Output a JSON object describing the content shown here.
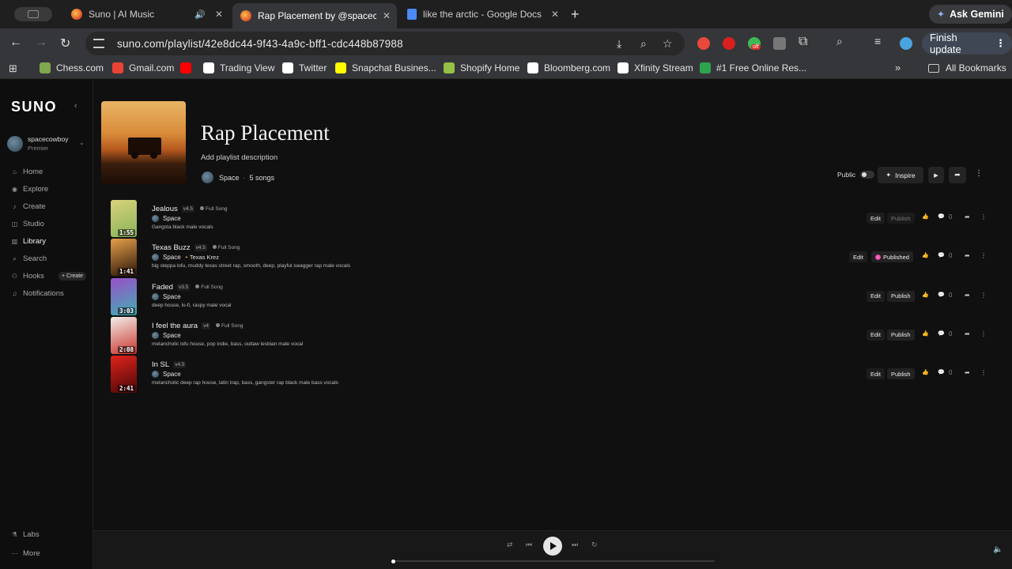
{
  "browser": {
    "tabs": [
      {
        "title": "Suno | AI Music",
        "active": false
      },
      {
        "title": "Rap Placement by @spacecowboy",
        "active": true
      },
      {
        "title": "like the arctic - Google Docs",
        "active": false
      }
    ],
    "ask_gemini": "Ask Gemini",
    "url_host": "suno.com",
    "url_path": "/playlist/42e8dc44-9f43-4a9c-bff1-cdc448b87988",
    "extension_badge": "off",
    "finish_update": "Finish update",
    "bookmarks": [
      {
        "label": "Chess.com",
        "icon": "chess-pawn-icon",
        "color": "#7fa650"
      },
      {
        "label": "Gmail.com",
        "icon": "gmail-icon",
        "color": "#ea4335"
      },
      {
        "label": "",
        "icon": "youtube-icon",
        "color": "#ff0000"
      },
      {
        "label": "Trading View",
        "icon": "tradingview-icon",
        "color": "#ffffff"
      },
      {
        "label": "Twitter",
        "icon": "x-icon",
        "color": "#ffffff"
      },
      {
        "label": "Snapchat Busines...",
        "icon": "snapchat-icon",
        "color": "#fffc00"
      },
      {
        "label": "Shopify Home",
        "icon": "shopify-icon",
        "color": "#95bf47"
      },
      {
        "label": "Bloomberg.com",
        "icon": "bloomberg-icon",
        "color": "#ffffff"
      },
      {
        "label": "Xfinity Stream",
        "icon": "xfinity-icon",
        "color": "#ffffff"
      },
      {
        "label": "#1 Free Online Res...",
        "icon": "resume-icon",
        "color": "#2ea44f"
      }
    ],
    "all_bookmarks": "All Bookmarks"
  },
  "sidebar": {
    "logo": "SUNO",
    "user": {
      "name": "spacecowboy",
      "plan": "Premier"
    },
    "items": [
      {
        "label": "Home",
        "icon": "home-icon"
      },
      {
        "label": "Explore",
        "icon": "compass-icon"
      },
      {
        "label": "Create",
        "icon": "music-note-icon"
      },
      {
        "label": "Studio",
        "icon": "studio-icon"
      },
      {
        "label": "Library",
        "icon": "library-icon",
        "active": true
      },
      {
        "label": "Search",
        "icon": "search-icon"
      },
      {
        "label": "Hooks",
        "icon": "hooks-icon"
      },
      {
        "label": "Notifications",
        "icon": "bell-icon"
      }
    ],
    "hooks_create": "+ Create",
    "bottom": [
      {
        "label": "Labs",
        "icon": "flask-icon"
      },
      {
        "label": "More",
        "icon": "more-icon"
      }
    ]
  },
  "playlist": {
    "title": "Rap Placement",
    "description_placeholder": "Add playlist description",
    "owner": "Space",
    "song_count": "5 songs",
    "public_label": "Public",
    "inspire_label": "Inspire"
  },
  "songs": [
    {
      "title": "Jealous",
      "version": "v4.5",
      "badge": "Full Song",
      "artist": "Space",
      "feature": "",
      "tags": "Gangsta black male vocals",
      "duration": "1:55",
      "edit": "Edit",
      "publish": "Publish",
      "published": false,
      "comments": "0",
      "thumb_colors": [
        "#d9d37a",
        "#89b35a"
      ]
    },
    {
      "title": "Texas Buzz",
      "version": "v4.5",
      "badge": "Full Song",
      "artist": "Space",
      "feature": "Texas Krez",
      "tags": "big steppa lofu, muddy texas street rap, smooth, deep, playful swagger rap male vocals",
      "duration": "1:41",
      "edit": "Edit",
      "publish": "Published",
      "published": true,
      "comments": "0",
      "thumb_colors": [
        "#e7a04b",
        "#2a1408"
      ]
    },
    {
      "title": "Faded",
      "version": "v3.5",
      "badge": "Full Song",
      "artist": "Space",
      "feature": "",
      "tags": "deep house, lo-fi, raspy male vocal",
      "duration": "3:03",
      "edit": "Edit",
      "publish": "Publish",
      "published": false,
      "comments": "0",
      "thumb_colors": [
        "#9b4fc9",
        "#3fb0b3"
      ]
    },
    {
      "title": "I feel the aura",
      "version": "v4",
      "badge": "Full Song",
      "artist": "Space",
      "feature": "",
      "tags": "melancholic lofu house, pop indie, bass, outlaw lesbian male vocal",
      "duration": "2:08",
      "edit": "Edit",
      "publish": "Publish",
      "published": false,
      "comments": "0",
      "thumb_colors": [
        "#f1efe9",
        "#c9342c"
      ]
    },
    {
      "title": "In SL",
      "version": "v4.5",
      "badge": "",
      "artist": "Space",
      "feature": "",
      "tags": "melancholic deep rap house, latin trap, bass, gangster rap black male bass vocals",
      "duration": "2:41",
      "edit": "Edit",
      "publish": "Publish",
      "published": false,
      "comments": "0",
      "thumb_colors": [
        "#e0231c",
        "#4a0706"
      ]
    }
  ],
  "player": {
    "progress": 0.0
  }
}
